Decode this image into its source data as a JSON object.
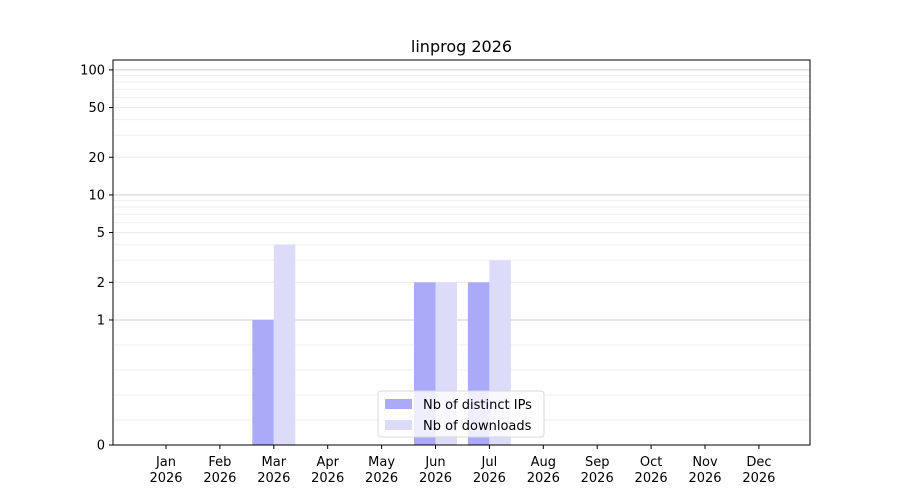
{
  "chart_data": {
    "type": "bar",
    "title": "linprog 2026",
    "xlabel": "",
    "ylabel": "",
    "yscale": "symlog",
    "ylim": [
      0,
      120
    ],
    "yticks": [
      0,
      1,
      2,
      5,
      10,
      20,
      50,
      100
    ],
    "grid": true,
    "legend_position": "lower-center",
    "categories": [
      {
        "month": "Jan",
        "year": "2026"
      },
      {
        "month": "Feb",
        "year": "2026"
      },
      {
        "month": "Mar",
        "year": "2026"
      },
      {
        "month": "Apr",
        "year": "2026"
      },
      {
        "month": "May",
        "year": "2026"
      },
      {
        "month": "Jun",
        "year": "2026"
      },
      {
        "month": "Jul",
        "year": "2026"
      },
      {
        "month": "Aug",
        "year": "2026"
      },
      {
        "month": "Sep",
        "year": "2026"
      },
      {
        "month": "Oct",
        "year": "2026"
      },
      {
        "month": "Nov",
        "year": "2026"
      },
      {
        "month": "Dec",
        "year": "2026"
      }
    ],
    "series": [
      {
        "name": "Nb of distinct IPs",
        "color": "#aaaaf8",
        "values": [
          0,
          0,
          1,
          0,
          0,
          2,
          2,
          0,
          0,
          0,
          0,
          0
        ]
      },
      {
        "name": "Nb of downloads",
        "color": "#dcdcf9",
        "values": [
          0,
          0,
          4,
          0,
          0,
          2,
          3,
          0,
          0,
          0,
          0,
          0
        ]
      }
    ]
  }
}
